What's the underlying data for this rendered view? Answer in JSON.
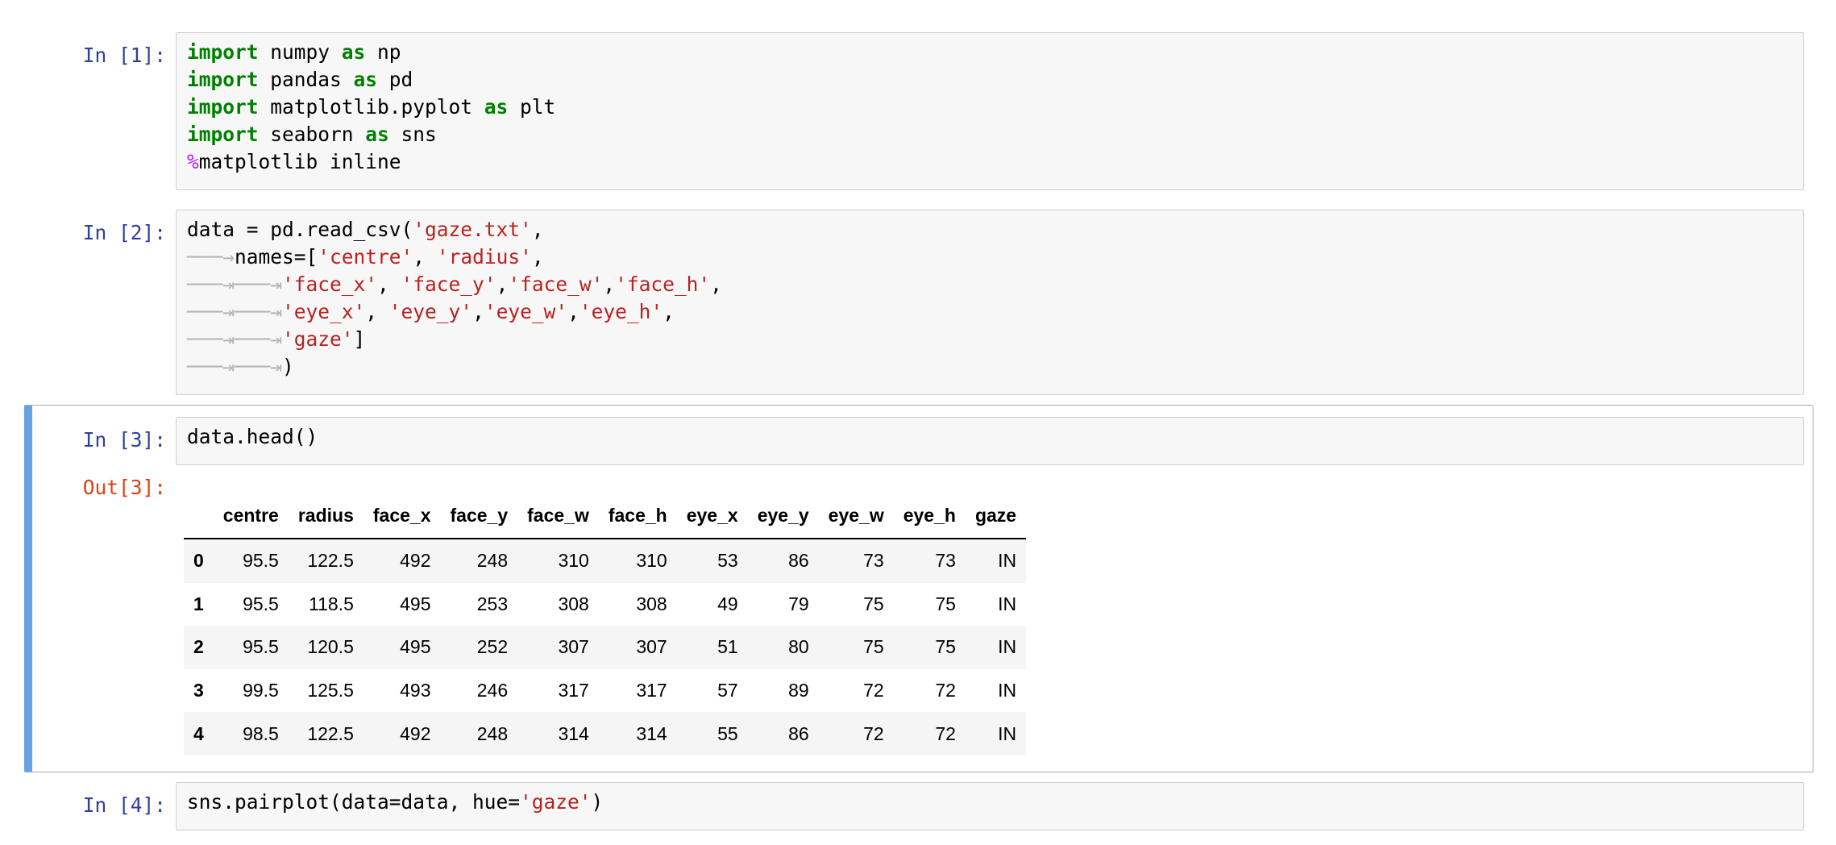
{
  "cells": [
    {
      "prompt": "In [1]:",
      "lines": [
        [
          {
            "t": "import",
            "c": "kw"
          },
          {
            "t": " numpy "
          },
          {
            "t": "as",
            "c": "kw"
          },
          {
            "t": " np"
          }
        ],
        [
          {
            "t": "import",
            "c": "kw"
          },
          {
            "t": " pandas "
          },
          {
            "t": "as",
            "c": "kw"
          },
          {
            "t": " pd"
          }
        ],
        [
          {
            "t": "import",
            "c": "kw"
          },
          {
            "t": " matplotlib.pyplot "
          },
          {
            "t": "as",
            "c": "kw"
          },
          {
            "t": " plt"
          }
        ],
        [
          {
            "t": "import",
            "c": "kw"
          },
          {
            "t": " seaborn "
          },
          {
            "t": "as",
            "c": "kw"
          },
          {
            "t": " sns"
          }
        ],
        [
          {
            "t": "%",
            "c": "magic"
          },
          {
            "t": "matplotlib inline"
          }
        ]
      ]
    },
    {
      "prompt": "In [2]:",
      "lines": [
        [
          {
            "t": "data = pd.read_csv("
          },
          {
            "t": "'gaze.txt'",
            "c": "str"
          },
          {
            "t": ","
          }
        ],
        [
          {
            "t": "───→",
            "c": "ws"
          },
          {
            "t": "names=["
          },
          {
            "t": "'centre'",
            "c": "str"
          },
          {
            "t": ", "
          },
          {
            "t": "'radius'",
            "c": "str"
          },
          {
            "t": ","
          }
        ],
        [
          {
            "t": "───⇥───⇥",
            "c": "ws"
          },
          {
            "t": "'face_x'",
            "c": "str"
          },
          {
            "t": ", "
          },
          {
            "t": "'face_y'",
            "c": "str"
          },
          {
            "t": ","
          },
          {
            "t": "'face_w'",
            "c": "str"
          },
          {
            "t": ","
          },
          {
            "t": "'face_h'",
            "c": "str"
          },
          {
            "t": ","
          }
        ],
        [
          {
            "t": "───⇥───⇥",
            "c": "ws"
          },
          {
            "t": "'eye_x'",
            "c": "str"
          },
          {
            "t": ", "
          },
          {
            "t": "'eye_y'",
            "c": "str"
          },
          {
            "t": ","
          },
          {
            "t": "'eye_w'",
            "c": "str"
          },
          {
            "t": ","
          },
          {
            "t": "'eye_h'",
            "c": "str"
          },
          {
            "t": ","
          }
        ],
        [
          {
            "t": "───⇥───⇥",
            "c": "ws"
          },
          {
            "t": "'gaze'",
            "c": "str"
          },
          {
            "t": "]"
          }
        ],
        [
          {
            "t": "───⇥───⇥",
            "c": "ws"
          },
          {
            "t": ")"
          }
        ]
      ]
    },
    {
      "prompt": "In [3]:",
      "out_prompt": "Out[3]:",
      "lines": [
        [
          {
            "t": "data.head()"
          }
        ]
      ]
    },
    {
      "prompt": "In [4]:",
      "lines": [
        [
          {
            "t": "sns.pairplot(data=data, hue="
          },
          {
            "t": "'gaze'",
            "c": "str"
          },
          {
            "t": ")"
          }
        ]
      ]
    }
  ],
  "dataframe": {
    "columns": [
      "centre",
      "radius",
      "face_x",
      "face_y",
      "face_w",
      "face_h",
      "eye_x",
      "eye_y",
      "eye_w",
      "eye_h",
      "gaze"
    ],
    "rows": [
      {
        "index": "0",
        "values": [
          "95.5",
          "122.5",
          "492",
          "248",
          "310",
          "310",
          "53",
          "86",
          "73",
          "73",
          "IN"
        ]
      },
      {
        "index": "1",
        "values": [
          "95.5",
          "118.5",
          "495",
          "253",
          "308",
          "308",
          "49",
          "79",
          "75",
          "75",
          "IN"
        ]
      },
      {
        "index": "2",
        "values": [
          "95.5",
          "120.5",
          "495",
          "252",
          "307",
          "307",
          "51",
          "80",
          "75",
          "75",
          "IN"
        ]
      },
      {
        "index": "3",
        "values": [
          "99.5",
          "125.5",
          "493",
          "246",
          "317",
          "317",
          "57",
          "89",
          "72",
          "72",
          "IN"
        ]
      },
      {
        "index": "4",
        "values": [
          "98.5",
          "122.5",
          "492",
          "248",
          "314",
          "314",
          "55",
          "86",
          "72",
          "72",
          "IN"
        ]
      }
    ]
  },
  "colors": {
    "keyword": "#008000",
    "string": "#ba2121",
    "magic": "#aa22ff",
    "in_prompt": "#303f9f",
    "out_prompt": "#d84315",
    "selected_cell_bar": "#66a3e0"
  }
}
